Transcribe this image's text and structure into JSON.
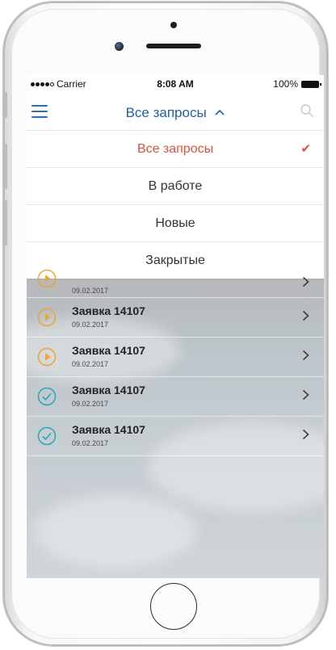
{
  "status_bar": {
    "carrier": "Carrier",
    "time": "8:08 AM",
    "battery": "100%"
  },
  "nav": {
    "title": "Все запросы",
    "caret": "^"
  },
  "dropdown": [
    {
      "label": "Все запросы",
      "selected": true
    },
    {
      "label": "В работе",
      "selected": false
    },
    {
      "label": "Новые",
      "selected": false
    },
    {
      "label": "Закрытые",
      "selected": false
    }
  ],
  "requests": [
    {
      "title": "",
      "date": "09.02.2017",
      "status": "in-progress"
    },
    {
      "title": "Заявка 14107",
      "date": "09.02.2017",
      "status": "in-progress"
    },
    {
      "title": "Заявка 14107",
      "date": "09.02.2017",
      "status": "in-progress"
    },
    {
      "title": "Заявка 14107",
      "date": "09.02.2017",
      "status": "completed"
    },
    {
      "title": "Заявка 14107",
      "date": "09.02.2017",
      "status": "completed"
    }
  ],
  "icons": {
    "menu": "hamburger-menu-icon",
    "search": "search-icon",
    "caret": "chevron-up-icon",
    "check": "checkmark-icon",
    "in_progress": "play-circle-icon",
    "completed": "check-circle-icon",
    "row_chevron": "chevron-right-icon"
  },
  "colors": {
    "accent": "#1f5fa8",
    "selected": "#e2513e",
    "in_progress": "#f0a23a",
    "completed": "#2aa6b8"
  }
}
